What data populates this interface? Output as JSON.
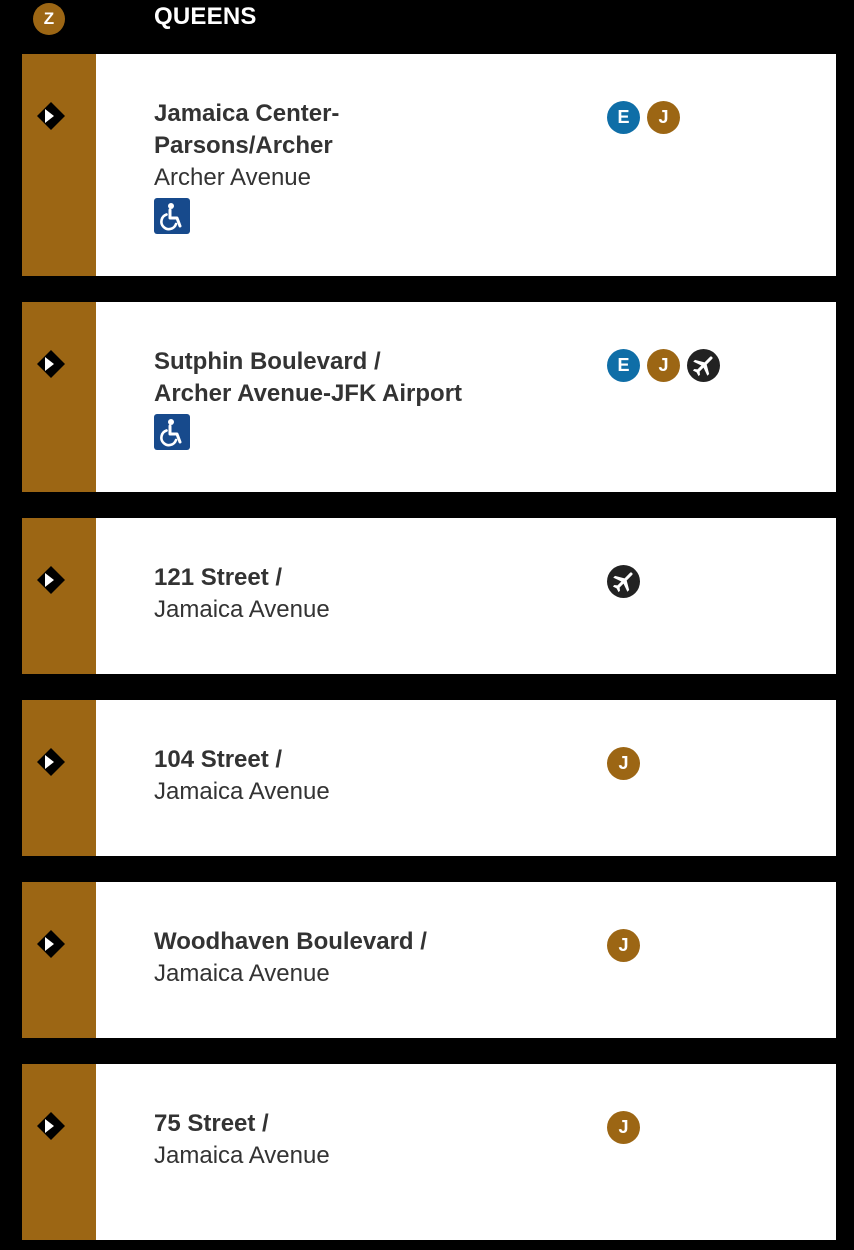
{
  "header": {
    "line_bullet": "Z",
    "borough": "QUEENS"
  },
  "colors": {
    "line": "#9c6614",
    "E": "#0f6ea7",
    "J": "#9c6614",
    "ada": "#174a8c",
    "airport": "#222222"
  },
  "stations": [
    {
      "name": "Jamaica Center-\nParsons/Archer",
      "street": "Archer Avenue",
      "ada": true,
      "routes": [
        "E",
        "J"
      ],
      "airport": false
    },
    {
      "name": "Sutphin Boulevard /\nArcher Avenue-JFK Airport",
      "street": "",
      "ada": true,
      "routes": [
        "E",
        "J"
      ],
      "airport": true
    },
    {
      "name": "121 Street /",
      "street": "Jamaica Avenue",
      "ada": false,
      "routes": [],
      "airport": true
    },
    {
      "name": "104 Street /",
      "street": "Jamaica Avenue",
      "ada": false,
      "routes": [
        "J"
      ],
      "airport": false
    },
    {
      "name": "Woodhaven Boulevard /",
      "street": "Jamaica Avenue",
      "ada": false,
      "routes": [
        "J"
      ],
      "airport": false
    },
    {
      "name": "75 Street /",
      "street": "Jamaica Avenue",
      "ada": false,
      "routes": [
        "J"
      ],
      "airport": false
    }
  ]
}
